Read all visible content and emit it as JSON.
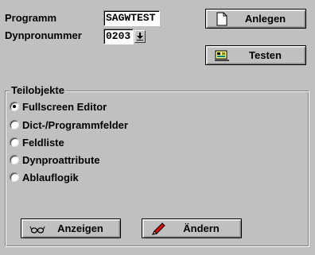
{
  "form": {
    "program_label": "Programm",
    "program_value": "SAGWTEST",
    "dynpro_label": "Dynpronummer",
    "dynpro_value": "0203"
  },
  "buttons": {
    "create_label": "Anlegen",
    "test_label": "Testen",
    "show_label": "Anzeigen",
    "change_label": "Ändern"
  },
  "subobjects": {
    "title": "Teilobjekte",
    "options": [
      {
        "label": "Fullscreen Editor",
        "selected": true
      },
      {
        "label": "Dict-/Programmfelder",
        "selected": false
      },
      {
        "label": "Feldliste",
        "selected": false
      },
      {
        "label": "Dynproattribute",
        "selected": false
      },
      {
        "label": "Ablauflogik",
        "selected": false
      }
    ]
  },
  "icons": {
    "create": "document-icon",
    "test": "test-tool-icon",
    "show": "glasses-icon",
    "change": "pencil-icon",
    "dropdown": "arrow-down-icon"
  }
}
